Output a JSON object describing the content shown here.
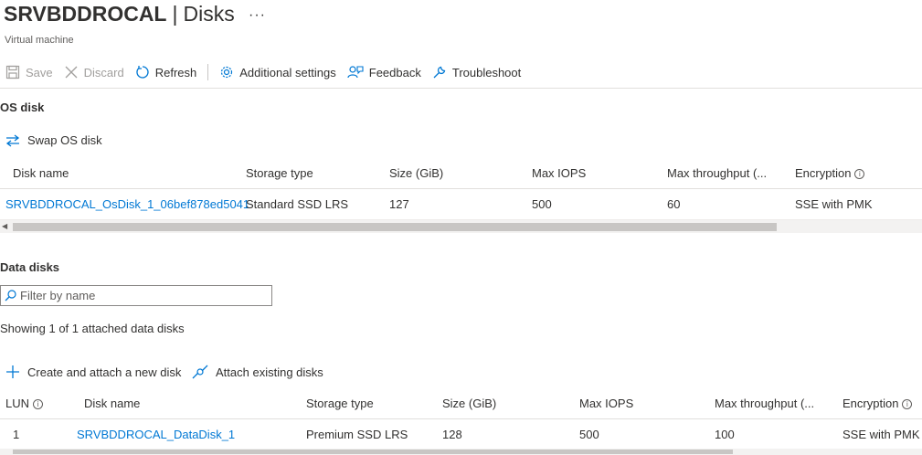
{
  "header": {
    "vm_name": "SRVBDDROCAL",
    "separator": "|",
    "page": "Disks",
    "more": "···",
    "subtitle": "Virtual machine"
  },
  "toolbar": {
    "save": "Save",
    "discard": "Discard",
    "refresh": "Refresh",
    "additional_settings": "Additional settings",
    "feedback": "Feedback",
    "troubleshoot": "Troubleshoot"
  },
  "os_disk": {
    "section_title": "OS disk",
    "swap_label": "Swap OS disk",
    "columns": [
      "Disk name",
      "Storage type",
      "Size (GiB)",
      "Max IOPS",
      "Max throughput (...",
      "Encryption"
    ],
    "row": {
      "disk_name": "SRVBDDROCAL_OsDisk_1_06bef878ed5041",
      "storage_type": "Standard SSD LRS",
      "size": "127",
      "max_iops": "500",
      "max_throughput": "60",
      "encryption": "SSE with PMK"
    }
  },
  "data_disks": {
    "section_title": "Data disks",
    "filter_placeholder": "Filter by name",
    "showing_text": "Showing 1 of 1 attached data disks",
    "create_attach": "Create and attach a new disk",
    "attach_existing": "Attach existing disks",
    "columns": [
      "LUN",
      "Disk name",
      "Storage type",
      "Size (GiB)",
      "Max IOPS",
      "Max throughput (...",
      "Encryption"
    ],
    "rows": [
      {
        "lun": "1",
        "disk_name": "SRVBDDROCAL_DataDisk_1",
        "storage_type": "Premium SSD LRS",
        "size": "128",
        "max_iops": "500",
        "max_throughput": "100",
        "encryption": "SSE with PMK"
      }
    ]
  },
  "colors": {
    "link": "#0078d4",
    "text": "#323130",
    "disabled": "#a19f9d",
    "border": "#e1dfdd"
  },
  "icons": {
    "save": "save-icon",
    "discard": "close-icon",
    "refresh": "refresh-icon",
    "settings": "gear-icon",
    "feedback": "feedback-icon",
    "troubleshoot": "wrench-icon",
    "swap": "swap-icon",
    "add": "plus-icon",
    "attach": "attach-icon",
    "search": "search-icon",
    "info": "info-icon"
  }
}
